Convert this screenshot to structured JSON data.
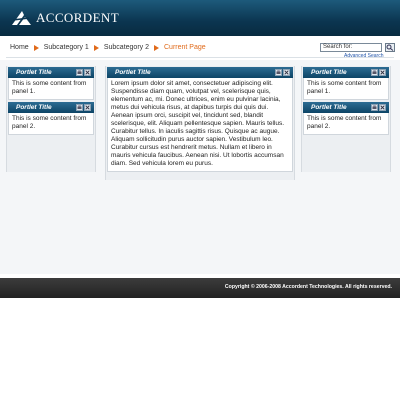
{
  "header": {
    "logo_text": "ACCORDENT",
    "logo_icon": "accordent-logo-icon"
  },
  "breadcrumb": {
    "items": [
      "Home",
      "Subcategory 1",
      "Subcategory 2"
    ],
    "current": "Current Page"
  },
  "search": {
    "placeholder": "Search for:",
    "advanced_label": "Advanced Search",
    "button_icon": "search-icon"
  },
  "portlets": {
    "left": [
      {
        "title": "Portlet Title",
        "body": "This is some content from panel 1."
      },
      {
        "title": "Portlet Title",
        "body": "This is some content from panel 2."
      }
    ],
    "middle": {
      "title": "Portlet Title",
      "body": "Lorem ipsum dolor sit amet, consectetuer adipiscing elit. Suspendisse diam quam, volutpat vel, scelerisque quis, elementum ac, mi. Donec ultrices, enim eu pulvinar lacinia, metus dui vehicula risus, at dapibus turpis dui quis dui. Aenean ipsum orci, suscipit vel, tincidunt sed, blandit scelerisque, elit. Aliquam pellentesque sapien. Mauris tellus. Curabitur tellus. In iaculis sagittis risus. Quisque ac augue. Aliquam sollicitudin purus auctor sapien. Vestibulum leo. Curabitur cursus est hendrerit metus. Nullam et libero in mauris vehicula faucibus. Aenean nisi. Ut lobortis accumsan diam. Sed vehicula lorem eu purus."
    },
    "right": [
      {
        "title": "Portlet Title",
        "body": "This is some content from panel 1."
      },
      {
        "title": "Portlet Title",
        "body": "This is some content from panel 2."
      }
    ],
    "button_icons": [
      "print-icon",
      "close-icon"
    ]
  },
  "footer": {
    "copyright": "Copyright © 2006-2008 Accordent Technologies. All rights reserved."
  }
}
